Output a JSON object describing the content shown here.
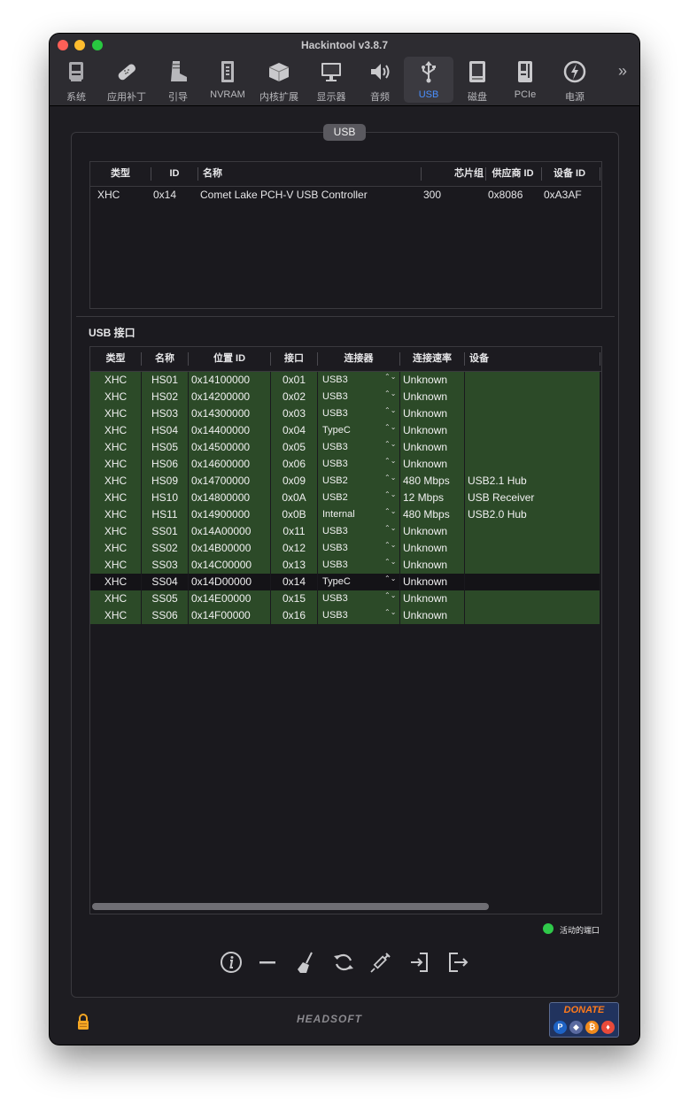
{
  "window": {
    "title": "Hackintool v3.8.7"
  },
  "toolbar": {
    "items": [
      {
        "label": "系统",
        "icon": "system-icon"
      },
      {
        "label": "应用补丁",
        "icon": "patch-icon"
      },
      {
        "label": "引导",
        "icon": "boot-icon"
      },
      {
        "label": "NVRAM",
        "icon": "nvram-icon"
      },
      {
        "label": "内核扩展",
        "icon": "kext-icon"
      },
      {
        "label": "显示器",
        "icon": "display-icon"
      },
      {
        "label": "音频",
        "icon": "audio-icon"
      },
      {
        "label": "USB",
        "icon": "usb-icon",
        "active": true
      },
      {
        "label": "磁盘",
        "icon": "disk-icon"
      },
      {
        "label": "PCIe",
        "icon": "pcie-icon"
      },
      {
        "label": "电源",
        "icon": "power-icon"
      }
    ],
    "more": "»"
  },
  "tab": {
    "label": "USB"
  },
  "controllers": {
    "headers": [
      "类型",
      "ID",
      "名称",
      "芯片组",
      "供应商 ID",
      "设备 ID"
    ],
    "rows": [
      [
        "XHC",
        "0x14",
        "Comet Lake PCH-V USB Controller",
        "300",
        "0x8086",
        "0xA3AF"
      ]
    ]
  },
  "ports": {
    "title": "USB 接口",
    "headers": [
      "类型",
      "名称",
      "位置 ID",
      "接口",
      "连接器",
      "连接速率",
      "设备"
    ],
    "rows": [
      {
        "type": "XHC",
        "name": "HS01",
        "loc": "0x14100000",
        "port": "0x01",
        "conn": "USB3",
        "speed": "Unknown",
        "device": "",
        "active": true
      },
      {
        "type": "XHC",
        "name": "HS02",
        "loc": "0x14200000",
        "port": "0x02",
        "conn": "USB3",
        "speed": "Unknown",
        "device": "",
        "active": true
      },
      {
        "type": "XHC",
        "name": "HS03",
        "loc": "0x14300000",
        "port": "0x03",
        "conn": "USB3",
        "speed": "Unknown",
        "device": "",
        "active": true
      },
      {
        "type": "XHC",
        "name": "HS04",
        "loc": "0x14400000",
        "port": "0x04",
        "conn": "TypeC",
        "speed": "Unknown",
        "device": "",
        "active": true
      },
      {
        "type": "XHC",
        "name": "HS05",
        "loc": "0x14500000",
        "port": "0x05",
        "conn": "USB3",
        "speed": "Unknown",
        "device": "",
        "active": true
      },
      {
        "type": "XHC",
        "name": "HS06",
        "loc": "0x14600000",
        "port": "0x06",
        "conn": "USB3",
        "speed": "Unknown",
        "device": "",
        "active": true
      },
      {
        "type": "XHC",
        "name": "HS09",
        "loc": "0x14700000",
        "port": "0x09",
        "conn": "USB2",
        "speed": "480 Mbps",
        "device": "USB2.1 Hub",
        "active": true
      },
      {
        "type": "XHC",
        "name": "HS10",
        "loc": "0x14800000",
        "port": "0x0A",
        "conn": "USB2",
        "speed": "12 Mbps",
        "device": "USB Receiver",
        "active": true
      },
      {
        "type": "XHC",
        "name": "HS11",
        "loc": "0x14900000",
        "port": "0x0B",
        "conn": "Internal",
        "speed": "480 Mbps",
        "device": "USB2.0 Hub",
        "active": true
      },
      {
        "type": "XHC",
        "name": "SS01",
        "loc": "0x14A00000",
        "port": "0x11",
        "conn": "USB3",
        "speed": "Unknown",
        "device": "",
        "active": true
      },
      {
        "type": "XHC",
        "name": "SS02",
        "loc": "0x14B00000",
        "port": "0x12",
        "conn": "USB3",
        "speed": "Unknown",
        "device": "",
        "active": true
      },
      {
        "type": "XHC",
        "name": "SS03",
        "loc": "0x14C00000",
        "port": "0x13",
        "conn": "USB3",
        "speed": "Unknown",
        "device": "",
        "active": true
      },
      {
        "type": "XHC",
        "name": "SS04",
        "loc": "0x14D00000",
        "port": "0x14",
        "conn": "TypeC",
        "speed": "Unknown",
        "device": "",
        "active": false
      },
      {
        "type": "XHC",
        "name": "SS05",
        "loc": "0x14E00000",
        "port": "0x15",
        "conn": "USB3",
        "speed": "Unknown",
        "device": "",
        "active": true
      },
      {
        "type": "XHC",
        "name": "SS06",
        "loc": "0x14F00000",
        "port": "0x16",
        "conn": "USB3",
        "speed": "Unknown",
        "device": "",
        "active": true
      }
    ]
  },
  "legend": {
    "label": "活动的端口",
    "color": "#2fc94a"
  },
  "actions": [
    "info-icon",
    "minus-icon",
    "broom-icon",
    "refresh-icon",
    "syringe-icon",
    "import-icon",
    "export-icon"
  ],
  "footer": {
    "brand": "HEADSOFT",
    "donate": "DONATE"
  },
  "colors": {
    "active_row": "#2c4a28",
    "accent": "#4a90ff"
  }
}
